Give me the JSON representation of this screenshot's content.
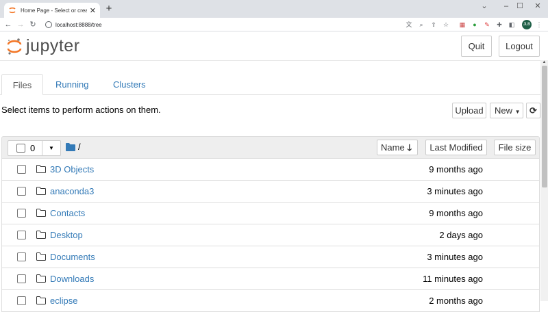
{
  "browser": {
    "tab_title": "Home Page - Select or create a",
    "tab_close": "✕",
    "new_tab": "+",
    "url": "localhost:8888/tree",
    "profile_initials": "JLB",
    "window_controls": [
      "⌄",
      "–",
      "☐",
      "✕"
    ]
  },
  "app": {
    "logo_text": "jupyter",
    "quit_label": "Quit",
    "logout_label": "Logout"
  },
  "tabs": [
    {
      "label": "Files",
      "active": true
    },
    {
      "label": "Running",
      "active": false
    },
    {
      "label": "Clusters",
      "active": false
    }
  ],
  "actions": {
    "select_text": "Select items to perform actions on them.",
    "upload_label": "Upload",
    "new_label": "New",
    "refresh_icon": "refresh-icon"
  },
  "list_header": {
    "selected_count": "0",
    "path": "/",
    "name_label": "Name",
    "last_modified_label": "Last Modified",
    "file_size_label": "File size"
  },
  "files": [
    {
      "name": "3D Objects",
      "modified": "9 months ago"
    },
    {
      "name": "anaconda3",
      "modified": "3 minutes ago"
    },
    {
      "name": "Contacts",
      "modified": "9 months ago"
    },
    {
      "name": "Desktop",
      "modified": "2 days ago"
    },
    {
      "name": "Documents",
      "modified": "3 minutes ago"
    },
    {
      "name": "Downloads",
      "modified": "11 minutes ago"
    },
    {
      "name": "eclipse",
      "modified": "2 months ago"
    }
  ],
  "colors": {
    "link": "#337ab7",
    "logo_orange": "#f37626",
    "header_bg": "#eeeeee"
  }
}
